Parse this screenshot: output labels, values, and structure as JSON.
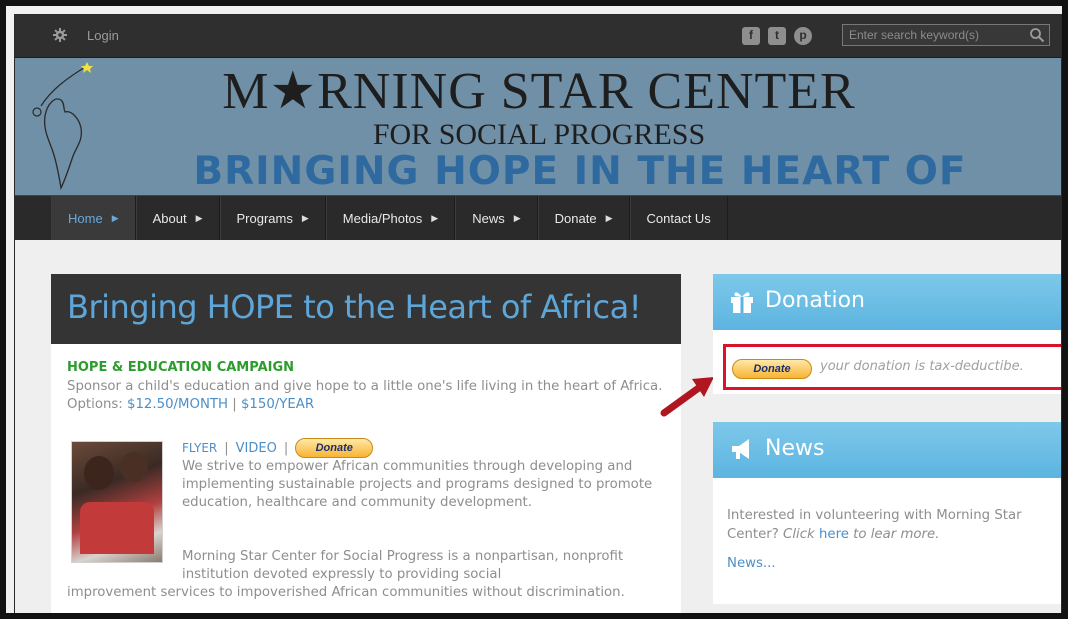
{
  "topbar": {
    "login_label": "Login",
    "social": [
      "facebook-icon",
      "twitter-icon",
      "pinterest-icon"
    ],
    "search_placeholder": "Enter search keyword(s)"
  },
  "banner": {
    "title_line1": "M★RNING STAR CENTER",
    "title_line2": "FOR SOCIAL PROGRESS",
    "tagline": "BRINGING HOPE IN THE HEART OF AFRICA",
    "tagline_color": "#2e6aa0"
  },
  "nav": {
    "items": [
      {
        "label": "Home",
        "active": true
      },
      {
        "label": "About"
      },
      {
        "label": "Programs"
      },
      {
        "label": "Media/Photos"
      },
      {
        "label": "News"
      },
      {
        "label": "Donate"
      },
      {
        "label": "Contact Us",
        "no_arrow": true
      }
    ]
  },
  "main": {
    "hero_title": "Bringing HOPE to the Heart of Africa!",
    "campaign_title": "HOPE & EDUCATION CAMPAIGN",
    "sponsor_text": "Sponsor a child's education and give hope to a little one's life living in the heart of Africa. Options: ",
    "option_month": "$12.50/MONTH",
    "option_sep": " | ",
    "option_year": "$150/YEAR",
    "flyer_label": "FLYER",
    "video_label": "VIDEO",
    "donate_label": "Donate",
    "para1": "We strive to empower African communities through developing and implementing sustainable projects and programs designed to promote education, healthcare and community development.",
    "para2a": "Morning Star Center for Social Progress is a nonpartisan, nonprofit institution devoted expressly to providing social",
    "para2b": "improvement services to impoverished African communities without discrimination."
  },
  "sidebar": {
    "donation_title": "Donation",
    "donate_label": "Donate",
    "tax_text": "your donation is tax-deductibe.",
    "news_title": "News",
    "news_text_pre": "Interested in volunteering with Morning Star Center? ",
    "news_click": "Click ",
    "news_here": "here",
    "news_text_post": " to lear more.",
    "news_more": "News..."
  },
  "colors": {
    "accent_blue": "#5ea6d8",
    "green": "#2d9b2d",
    "highlight_red": "#d9142a"
  }
}
